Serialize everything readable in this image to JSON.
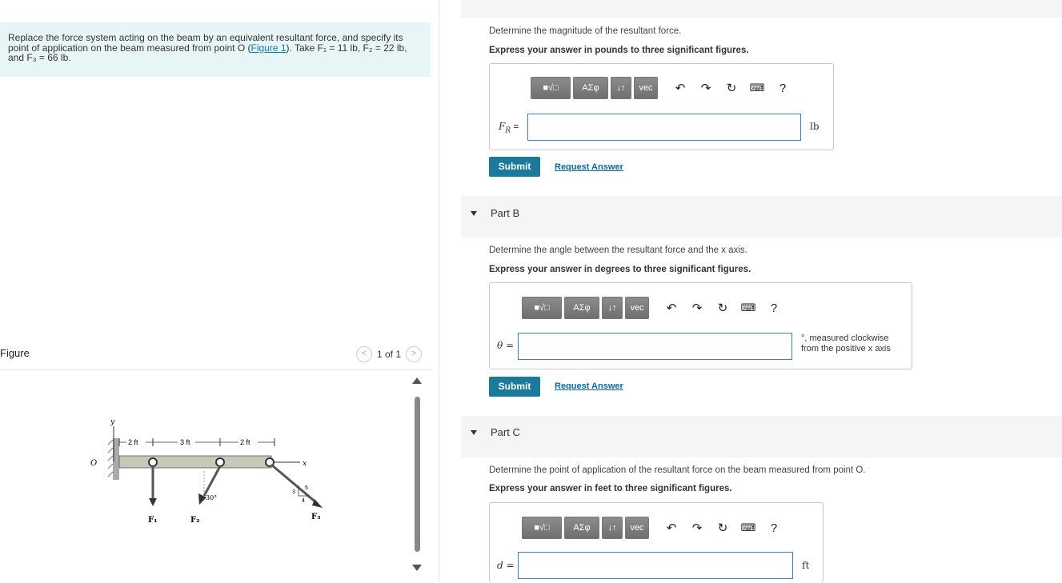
{
  "problem": {
    "text_before_link": "Replace the force system acting on the beam by an equivalent resultant force, and specify its point of application on the beam measured from point O (",
    "link": "Figure 1",
    "text_after_link": "). Take F₁ = 11 lb, F₂ = 22 lb, and F₃ = 66 lb."
  },
  "figure": {
    "label": "Figure",
    "counter": "1 of 1",
    "dims": [
      "2 ft",
      "3 ft",
      "2 ft"
    ],
    "angle": "30°",
    "forces": [
      "F₁",
      "F₂",
      "F₃"
    ],
    "slope": [
      "3",
      "5",
      "4"
    ],
    "axes": {
      "origin": "O",
      "x": "x",
      "y": "y"
    }
  },
  "toolbar": {
    "templates": "■√□",
    "greek": "ΑΣφ",
    "arrows": "↓↑",
    "vec": "vec",
    "help": "?"
  },
  "partA": {
    "question": "Determine the magnitude of the resultant force.",
    "instruction": "Express your answer in pounds to three significant figures.",
    "var": "F",
    "var_sub": "R",
    "eq": " =",
    "unit": "lb",
    "submit": "Submit",
    "request": "Request Answer"
  },
  "partB": {
    "title": "Part B",
    "question": "Determine the angle between the resultant force and the x axis.",
    "instruction": "Express your answer in degrees to three significant figures.",
    "var": "θ =",
    "unit_line1": "°, measured clockwise",
    "unit_line2": "from the positive x axis",
    "submit": "Submit",
    "request": "Request Answer"
  },
  "partC": {
    "title": "Part C",
    "question": "Determine the point of application of the resultant force on the beam measured from point O.",
    "instruction": "Express your answer in feet to three significant figures.",
    "var": "d =",
    "unit": "ft"
  }
}
